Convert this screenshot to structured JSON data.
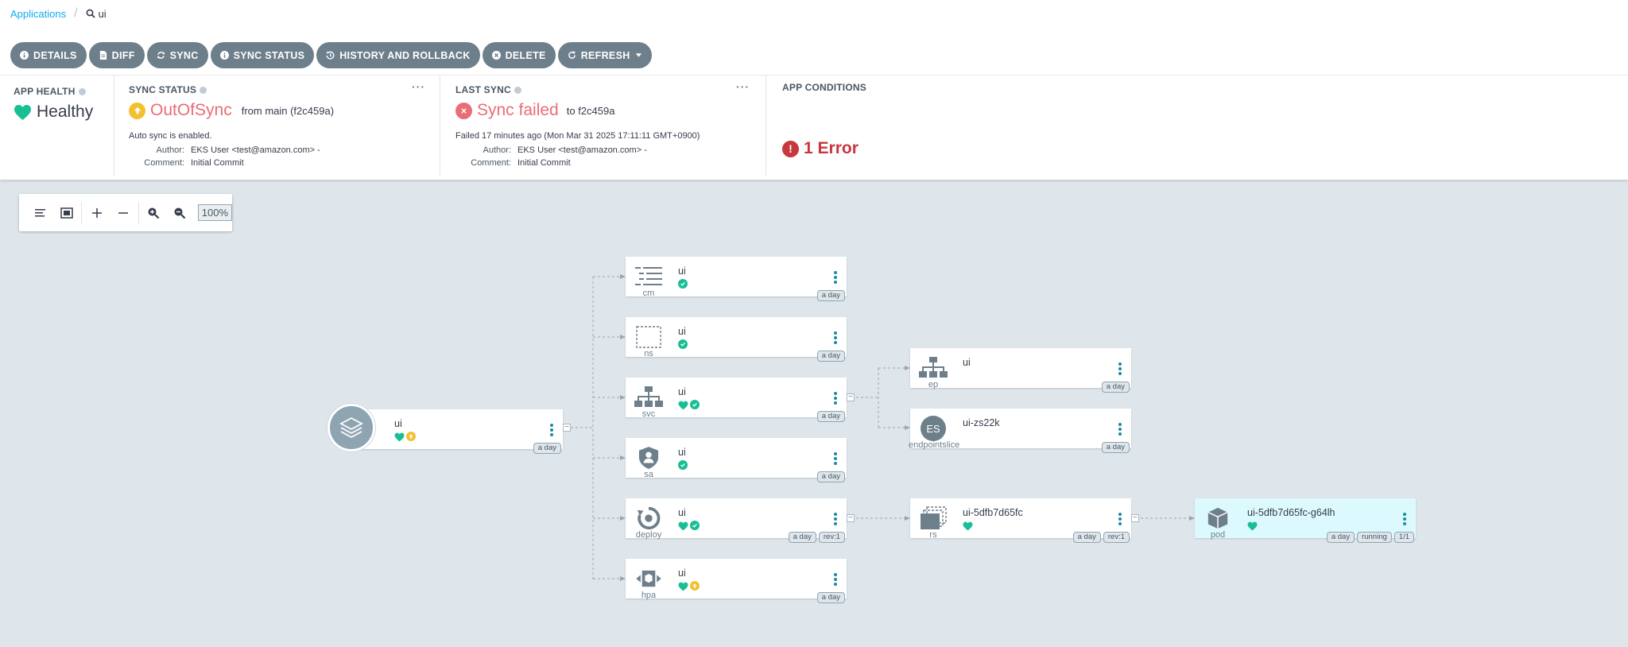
{
  "breadcrumb": {
    "root": "Applications",
    "current": "ui"
  },
  "actions": [
    {
      "label": "DETAILS",
      "icon": "info-icon"
    },
    {
      "label": "DIFF",
      "icon": "file-icon"
    },
    {
      "label": "SYNC",
      "icon": "sync-icon"
    },
    {
      "label": "SYNC STATUS",
      "icon": "info-icon"
    },
    {
      "label": "HISTORY AND ROLLBACK",
      "icon": "history-icon"
    },
    {
      "label": "DELETE",
      "icon": "delete-icon"
    },
    {
      "label": "REFRESH",
      "icon": "refresh-icon"
    }
  ],
  "status": {
    "app_health": {
      "title": "APP HEALTH",
      "value": "Healthy"
    },
    "sync_status": {
      "title": "SYNC STATUS",
      "value": "OutOfSync",
      "from": "from main (f2c459a)",
      "auto": "Auto sync is enabled.",
      "author_label": "Author:",
      "author": "EKS User <test@amazon.com> -",
      "comment_label": "Comment:",
      "comment": "Initial Commit",
      "more": "···"
    },
    "last_sync": {
      "title": "LAST SYNC",
      "value": "Sync failed",
      "to": "to f2c459a",
      "time": "Failed 17 minutes ago (Mon Mar 31 2025 17:11:11 GMT+0900)",
      "author_label": "Author:",
      "author": "EKS User <test@amazon.com> -",
      "comment_label": "Comment:",
      "comment": "Initial Commit",
      "more": "···"
    },
    "conditions": {
      "title": "APP CONDITIONS",
      "value": "1 Error"
    }
  },
  "graph_toolbar": {
    "zoom": "100%"
  },
  "colors": {
    "accent": "#0dadea",
    "healthy": "#18be94",
    "outofsync": "#f4c030",
    "error": "#e96d76",
    "button": "#6d7f8b"
  },
  "nodes": {
    "root": {
      "name": "ui",
      "age": "a day"
    },
    "cm": {
      "kind": "cm",
      "name": "ui",
      "age": "a day"
    },
    "ns": {
      "kind": "ns",
      "name": "ui",
      "age": "a day"
    },
    "svc": {
      "kind": "svc",
      "name": "ui",
      "age": "a day"
    },
    "sa": {
      "kind": "sa",
      "name": "ui",
      "age": "a day"
    },
    "deploy": {
      "kind": "deploy",
      "name": "ui",
      "age": "a day",
      "rev": "rev:1"
    },
    "hpa": {
      "kind": "hpa",
      "name": "ui",
      "age": "a day"
    },
    "ep": {
      "kind": "ep",
      "name": "ui",
      "age": "a day"
    },
    "endpointslice": {
      "kind": "endpointslice",
      "name": "ui-zs22k",
      "age": "a day",
      "badge": "ES"
    },
    "rs": {
      "kind": "rs",
      "name": "ui-5dfb7d65fc",
      "age": "a day",
      "rev": "rev:1"
    },
    "pod": {
      "kind": "pod",
      "name": "ui-5dfb7d65fc-g64lh",
      "age": "a day",
      "state": "running",
      "ready": "1/1"
    }
  },
  "collapse_symbol": "−"
}
